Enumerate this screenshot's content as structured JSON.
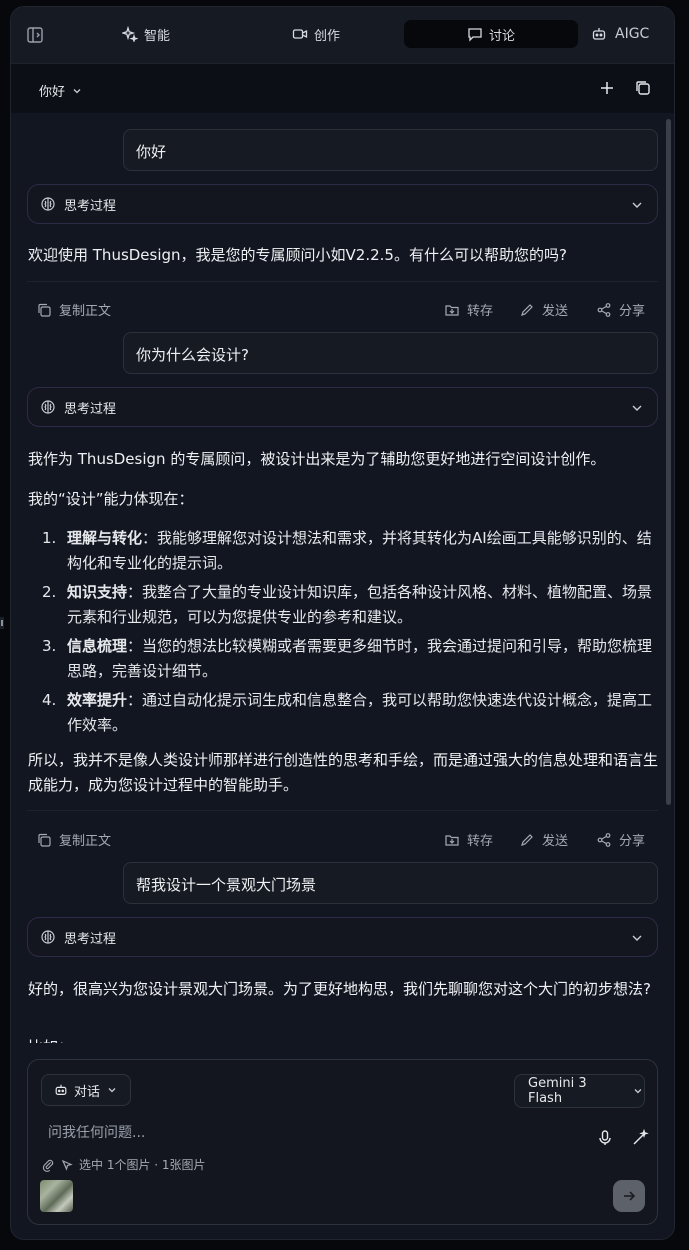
{
  "tabs": [
    {
      "label": "智能",
      "icon": "sparkle-icon"
    },
    {
      "label": "创作",
      "icon": "video-icon"
    },
    {
      "label": "讨论",
      "icon": "chat-icon",
      "active": true
    },
    {
      "label": "AIGC",
      "icon": "robot-icon"
    }
  ],
  "conversation": {
    "title": "你好"
  },
  "messages": [
    {
      "user": "你好",
      "thinking_label": "思考过程",
      "answer": "欢迎使用 ThusDesign，我是您的专属顾问小如V2.2.5。有什么可以帮助您的吗?"
    },
    {
      "user": "你为什么会设计?",
      "thinking_label": "思考过程",
      "answer_intro": "我作为 ThusDesign 的专属顾问，被设计出来是为了辅助您更好地进行空间设计创作。",
      "answer_lead": "我的“设计”能力体现在：",
      "points": [
        {
          "num": "1.",
          "title": "理解与转化",
          "text": "：我能够理解您对设计想法和需求，并将其转化为AI绘画工具能够识别的、结构化和专业化的提示词。"
        },
        {
          "num": "2.",
          "title": "知识支持",
          "text": "：我整合了大量的专业设计知识库，包括各种设计风格、材料、植物配置、场景元素和行业规范，可以为您提供专业的参考和建议。"
        },
        {
          "num": "3.",
          "title": "信息梳理",
          "text": "：当您的想法比较模糊或者需要更多细节时，我会通过提问和引导，帮助您梳理思路，完善设计细节。"
        },
        {
          "num": "4.",
          "title": "效率提升",
          "text": "：通过自动化提示词生成和信息整合，我可以帮助您快速迭代设计概念，提高工作效率。"
        }
      ],
      "answer_outro": "所以，我并不是像人类设计师那样进行创造性的思考和手绘，而是通过强大的信息处理和语言生成能力，成为您设计过程中的智能助手。"
    },
    {
      "user": "帮我设计一个景观大门场景",
      "thinking_label": "思考过程",
      "answer": "好的，很高兴为您设计景观大门场景。为了更好地构思，我们先聊聊您对这个大门的初步想法?",
      "answer_more": "比如："
    }
  ],
  "actions": {
    "copy": "复制正文",
    "save": "转存",
    "send": "发送",
    "share": "分享"
  },
  "composer": {
    "mode": "对话",
    "model": "Gemini 3 Flash",
    "placeholder": "问我任何问题...",
    "selection_info": "选中 1个图片 · 1张图片"
  }
}
